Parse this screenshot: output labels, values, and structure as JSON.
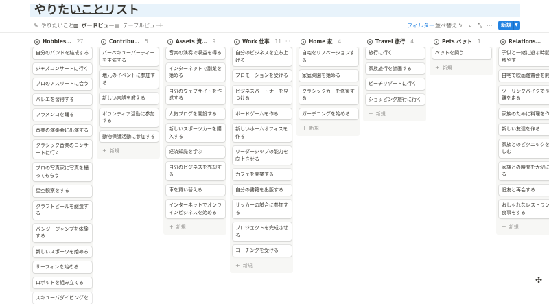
{
  "page": {
    "title": "やりたいことリスト"
  },
  "tabs": [
    {
      "icon": "✎",
      "icon_name": "pencil-icon",
      "label": "やりたいこと"
    },
    {
      "icon": "▥",
      "icon_name": "board-icon",
      "label": "ボードビュー"
    },
    {
      "icon": "▤",
      "icon_name": "table-icon",
      "label": "テーブルビュー"
    }
  ],
  "toolbar": {
    "add_view": "+",
    "filter": "フィルター",
    "sort": "並べ替え",
    "lightning_icon": "ϟ",
    "search_icon": "⌕",
    "expand_icon": "⤡",
    "more_icon": "···",
    "new_label": "新規",
    "new_chevron": "▼"
  },
  "new_card_label": "新規",
  "new_card_plus": "+",
  "column_more": "···",
  "corner_icon": "✣",
  "columns": [
    {
      "name": "Hobbies…",
      "count": "27",
      "cards": [
        "自分のバンドを結成する",
        "ジャズコンサートに行く",
        "プロのアスリートに会う",
        "バレエを習得する",
        "フラメンコを踊る",
        "音楽の演奏会に出演する",
        "クラシック音楽のコンサートに行く",
        "プロの写真家に写真を撮ってもらう",
        "星空観察をする",
        "クラフトビールを醸造する",
        "バンジージャンプを体験する",
        "新しいスポーツを始める",
        "サーフィンを始める",
        "ロボットを組み立てる",
        "スキューバダイビングを"
      ]
    },
    {
      "name": "Contribu…",
      "count": "5",
      "cards": [
        "バーベキューパーティーを主催する",
        "地元のイベントに参加する",
        "新しい言語を教える",
        "ボランティア活動に参加する",
        "動物保護活動に参加する"
      ]
    },
    {
      "name": "Assets 資…",
      "count": "9",
      "cards": [
        "音楽の演奏で収益を得る",
        "インターネットで副業を始める",
        "自分のウェブサイトを作成する",
        "人気ブログを開設する",
        "新しいスポーツカーを購入する",
        "経済知識を学ぶ",
        "自分のビジネスを売却する",
        "車を買い替える",
        "インターネットでオンラインビジネスを始める"
      ]
    },
    {
      "name": "Work 仕事",
      "count": "11",
      "cards": [
        "自分のビジネスを立ち上げる",
        "プロモーションを受ける",
        "ビジネスパートナーを見つける",
        "ボードゲームを作る",
        "新しいホームオフィスを作る",
        "リーダーシップの能力を向上させる",
        "カフェを開業する",
        "自分の書籍を出版する",
        "サッカーの試合に参加する",
        "プロジェクトを完成させる",
        "コーチングを受ける"
      ]
    },
    {
      "name": "Home 家",
      "count": "4",
      "cards": [
        "自宅をリノベーションする",
        "家庭菜園を始める",
        "クラシックカーを修復する",
        "ガーデニングを始める"
      ]
    },
    {
      "name": "Travel 旅行",
      "count": "4",
      "cards": [
        "旅行に行く",
        "家族旅行を計画する",
        "ビーチリゾートに行く",
        "ショッピング旅行に行く"
      ]
    },
    {
      "name": "Pets ペット",
      "count": "1",
      "cards": [
        "ペットを飼う"
      ]
    },
    {
      "name": "Relations…",
      "count": "",
      "cards": [
        "子供と一緒に遊ぶ時間を増やす",
        "自宅で映画鑑賞会を開く",
        "ツーリングバイクで長距離を走る",
        "家族のために料理を作る",
        "新しい友達を作る",
        "家族とのピクニックを楽しむ",
        "家族との時間を大切にする",
        "旧友と再会する",
        "おしゃれなレストランで食事をする"
      ]
    }
  ]
}
